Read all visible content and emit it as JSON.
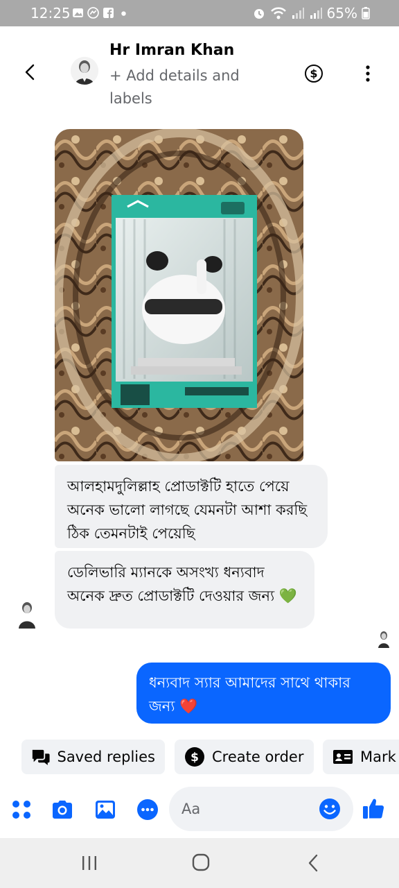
{
  "status_bar": {
    "time": "12:25",
    "battery": "65%"
  },
  "header": {
    "contact_name": "Hr Imran Khan",
    "add_details": "+ Add details and labels"
  },
  "messages": [
    {
      "type": "image",
      "from": "contact",
      "alt_icons": [
        "earbuds-product-photo"
      ]
    },
    {
      "type": "text",
      "from": "contact",
      "text": "আলহামদুলিল্লাহ প্রোডাক্টটি হাতে পেয়ে অনেক ভালো লাগছে যেমনটা আশা করছি ঠিক তেমনটাই পেয়েছি"
    },
    {
      "type": "text",
      "from": "contact",
      "text": "ডেলিভারি ম্যানকে অসংখ্য ধন্যবাদ অনেক দ্রুত প্রোডাক্টটি দেওয়ার জন্য",
      "emoji": "💚"
    },
    {
      "type": "text",
      "from": "me",
      "text": "ধন্যবাদ স্যার আমাদের সাথে থাকার জন্য",
      "emoji": "❤️"
    }
  ],
  "quick_replies": [
    {
      "label": "Saved replies",
      "icon": "chat-bubbles-icon"
    },
    {
      "label": "Create order",
      "icon": "dollar-icon"
    },
    {
      "label": "Mark",
      "icon": "contact-card-icon"
    }
  ],
  "composer": {
    "placeholder": "Aa"
  },
  "colors": {
    "accent": "#0a66ff",
    "incoming_bubble": "#f0f1f3",
    "status_bar": "#a9a9a9"
  }
}
